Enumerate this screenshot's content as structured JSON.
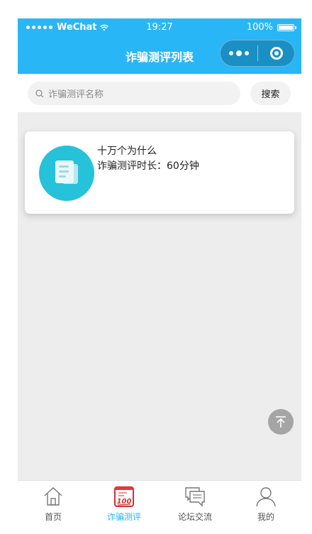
{
  "status_bar": {
    "carrier": "WeChat",
    "time": "19:27",
    "battery": "100%"
  },
  "nav": {
    "title": "诈骗测评列表"
  },
  "search": {
    "placeholder": "诈骗测评名称",
    "button_label": "搜索"
  },
  "list": [
    {
      "title": "十万个为什么",
      "duration": "诈骗测评时长：60分钟",
      "icon": "document-icon"
    }
  ],
  "tabbar": {
    "items": [
      {
        "label": "首页",
        "icon": "home-icon",
        "active": false
      },
      {
        "label": "诈骗测评",
        "icon": "score-100-icon",
        "active": true
      },
      {
        "label": "论坛交流",
        "icon": "chat-bubbles-icon",
        "active": false
      },
      {
        "label": "我的",
        "icon": "user-icon",
        "active": false
      }
    ]
  },
  "colors": {
    "primary": "#29b6f6",
    "icon_teal": "#26c2d9",
    "tab_red": "#e53935",
    "background": "#ededed"
  }
}
